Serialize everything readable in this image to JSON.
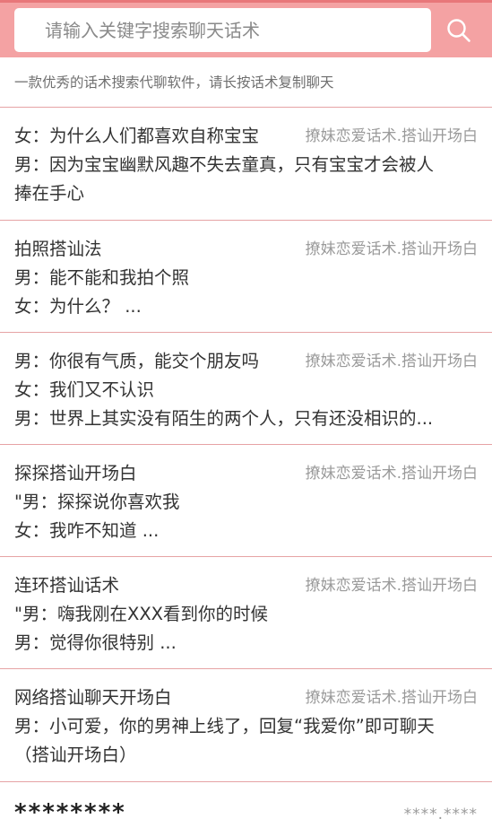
{
  "search": {
    "placeholder": "请输入关键字搜索聊天话术"
  },
  "tagline": "一款优秀的话术搜索代聊软件，请长按话术复制聊天",
  "items": [
    {
      "lines": [
        "女：为什么人们都喜欢自称宝宝",
        "男：因为宝宝幽默风趣不失去童真，只有宝宝才会被人",
        "捧在手心"
      ],
      "tag": "撩妹恋爱话术.搭讪开场白"
    },
    {
      "lines": [
        "拍照搭讪法",
        "男：能不能和我拍个照",
        "女：为什么？ ..."
      ],
      "tag": "撩妹恋爱话术.搭讪开场白"
    },
    {
      "lines": [
        "男：你很有气质，能交个朋友吗",
        "女：我们又不认识",
        "男：世界上其实没有陌生的两个人，只有还没相识的..."
      ],
      "tag": "撩妹恋爱话术.搭讪开场白"
    },
    {
      "lines": [
        "探探搭讪开场白",
        "\"男：探探说你喜欢我",
        "女：我咋不知道 ..."
      ],
      "tag": "撩妹恋爱话术.搭讪开场白"
    },
    {
      "lines": [
        "连环搭讪话术",
        "\"男：嗨我刚在XXX看到你的时候",
        "男：觉得你很特别 ..."
      ],
      "tag": "撩妹恋爱话术.搭讪开场白"
    },
    {
      "lines": [
        "网络搭讪聊天开场白",
        "男：小可爱，你的男神上线了，回复“我爱你”即可聊天",
        "（搭讪开场白）"
      ],
      "tag": "撩妹恋爱话术.搭讪开场白"
    }
  ],
  "last_item": {
    "text": "********",
    "tag": "****.****"
  },
  "colors": {
    "header": "#f4a2a3",
    "divider": "#e6a3a5"
  },
  "icons": {
    "search": "search-icon"
  }
}
